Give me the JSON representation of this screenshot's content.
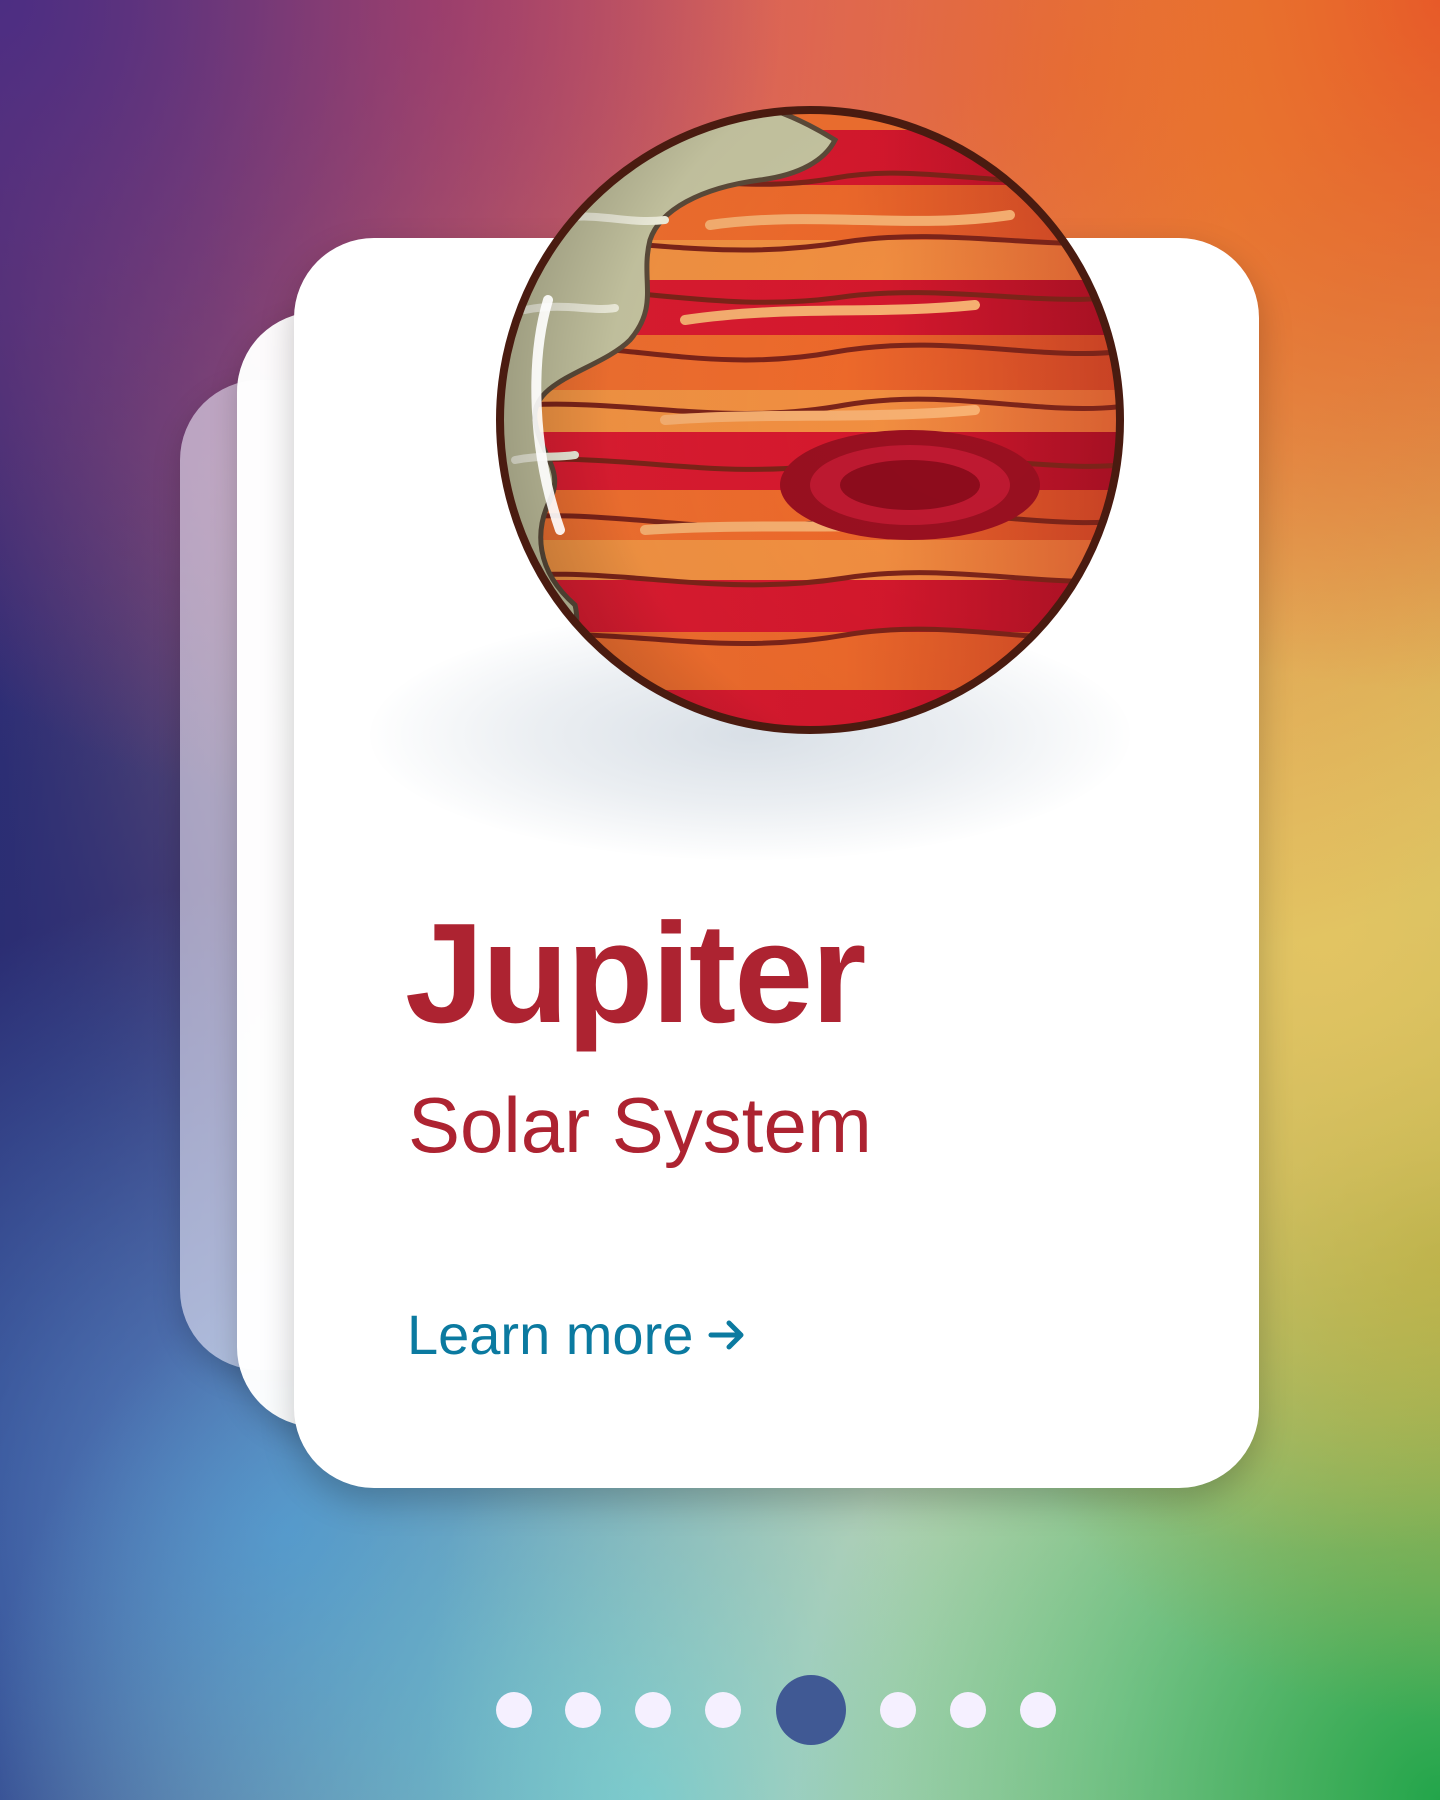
{
  "card": {
    "title": "Jupiter",
    "subtitle": "Solar System",
    "learn_more": "Learn more"
  },
  "icons": {
    "arrow": "arrow-right-icon",
    "planet": "jupiter-planet-icon"
  },
  "pagination": {
    "total": 8,
    "active_index": 4
  },
  "colors": {
    "title": "#ad2331",
    "link": "#0b7aa0",
    "active_dot": "#405994",
    "inactive_dot": "#f5f0ff"
  }
}
